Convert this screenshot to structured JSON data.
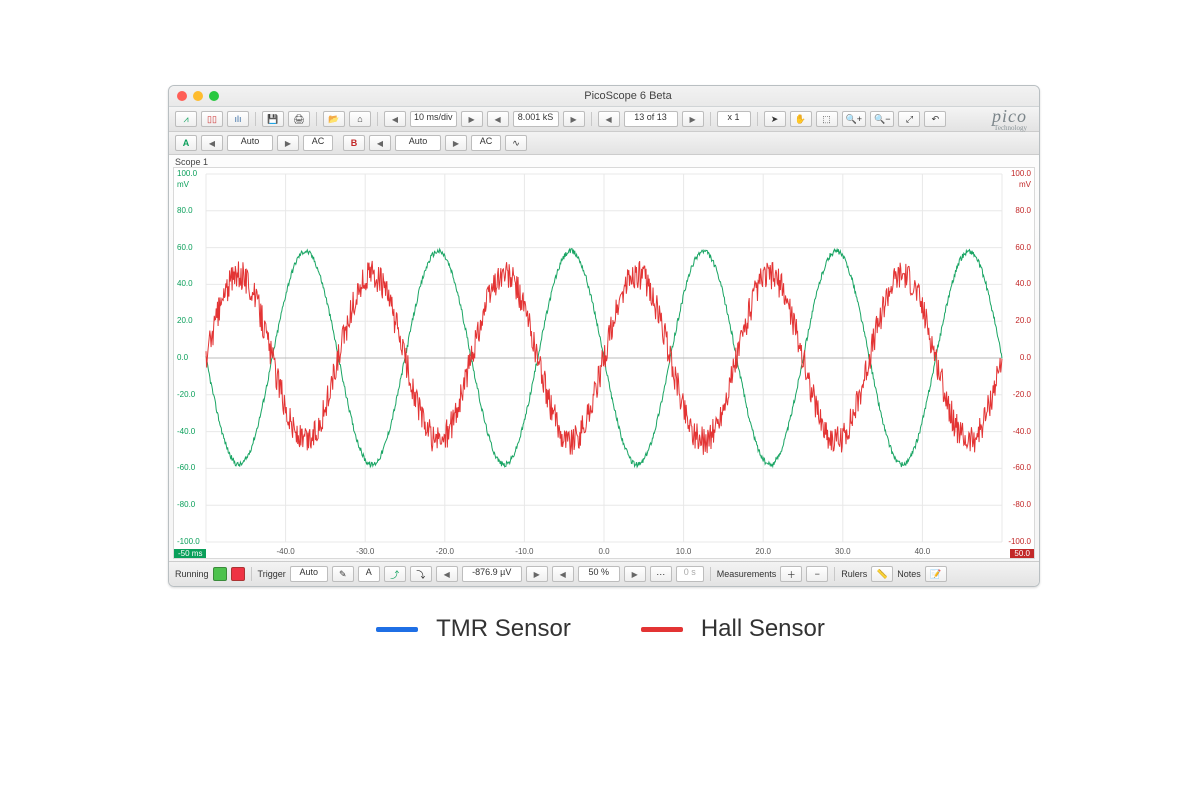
{
  "window": {
    "title": "PicoScope 6 Beta"
  },
  "toolbar": {
    "timebase": "10 ms/div",
    "samples": "8.001 kS",
    "buffer_pos": "13 of 13",
    "zoom_x": "x 1"
  },
  "channels": {
    "A": {
      "name": "A",
      "range": "Auto",
      "coupling": "AC"
    },
    "B": {
      "name": "B",
      "range": "Auto",
      "coupling": "AC"
    }
  },
  "scope": {
    "label": "Scope 1",
    "unit_left": "mV",
    "unit_right": "mV",
    "time_unit_left": "-50 ms",
    "time_unit_right": "50.0",
    "y_ticks": [
      "100.0",
      "80.0",
      "60.0",
      "40.0",
      "20.0",
      "0.0",
      "-20.0",
      "-40.0",
      "-60.0",
      "-80.0",
      "-100.0"
    ],
    "x_ticks": [
      "-40.0",
      "-30.0",
      "-20.0",
      "-10.0",
      "0.0",
      "10.0",
      "20.0",
      "30.0",
      "40.0"
    ]
  },
  "status": {
    "state": "Running",
    "trigger_label": "Trigger",
    "trigger_mode": "Auto",
    "channel": "A",
    "level": "-876.9 µV",
    "pretrigger": "50 %",
    "measurements_label": "Measurements",
    "rulers_label": "Rulers",
    "notes_label": "Notes"
  },
  "legend": {
    "tmr": "TMR Sensor",
    "hall": "Hall Sensor"
  },
  "colors": {
    "channel_a": "#1aa564",
    "channel_b": "#e33434",
    "grid": "#e8e8e8"
  },
  "chart_data": {
    "type": "line",
    "xlabel": "ms",
    "ylabel": "mV",
    "x_range": [
      -50,
      50
    ],
    "y_range": [
      -100,
      100
    ],
    "series": [
      {
        "name": "TMR Sensor (Channel A, green)",
        "color": "#1aa564",
        "waveform": "sine",
        "amplitude_mV": 58,
        "offset_mV": 0,
        "period_ms": 16.67,
        "phase_at_x0_deg": 180,
        "frequency_hz": 60,
        "noise_rms_mV": 1.5
      },
      {
        "name": "Hall Sensor (Channel B, red)",
        "color": "#e33434",
        "waveform": "sine",
        "amplitude_mV": 45,
        "offset_mV": 0,
        "period_ms": 16.67,
        "phase_at_x0_deg": 0,
        "frequency_hz": 60,
        "noise_rms_mV": 8
      }
    ]
  }
}
